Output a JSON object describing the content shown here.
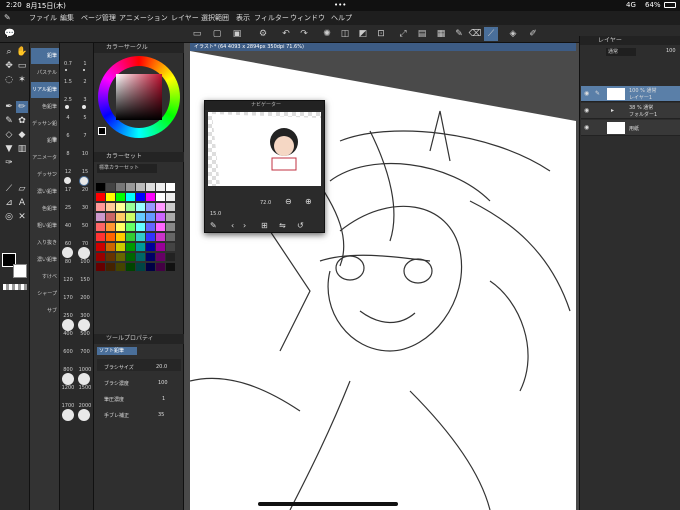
{
  "status": {
    "time": "2:20",
    "date": "8月15日(木)",
    "dots": "•••",
    "signal": "4G",
    "battery": "64%"
  },
  "menu": [
    "ファイル",
    "編集",
    "ページ管理",
    "アニメーション",
    "レイヤー",
    "選択範囲",
    "表示",
    "フィルター",
    "ウィンドウ",
    "ヘルプ"
  ],
  "document": {
    "tab": "イラスト* (64 4093 x 2894px 350dpi 71.6%)"
  },
  "subtools": [
    "鉛筆",
    "パステル",
    "リアル鉛筆",
    "色鉛筆",
    "デッサン鉛筆",
    "鉛筆",
    "アニメーター",
    "デッサン",
    "濃い鉛筆",
    "色鉛筆",
    "粗い鉛筆",
    "入り抜き",
    "濃い鉛筆",
    "すけべ",
    "シャープ",
    "サブ"
  ],
  "brush_sizes": [
    "0.7",
    "1",
    "1.5",
    "2",
    "2.5",
    "3",
    "4",
    "5",
    "6",
    "7",
    "8",
    "10",
    "12",
    "15",
    "17",
    "20",
    "25",
    "30",
    "40",
    "50",
    "60",
    "70",
    "80",
    "100",
    "120",
    "150",
    "170",
    "200",
    "250",
    "300",
    "400",
    "500",
    "600",
    "700",
    "800",
    "1000",
    "1200",
    "1500",
    "1700",
    "2000"
  ],
  "panels": {
    "color_wheel": "カラーサークル",
    "color_set": "カラーセット",
    "color_set_name": "標準カラーセット",
    "tool_property": "ツールプロパティ",
    "tool_name": "ソフト鉛筆",
    "navigator": "ナビゲーター",
    "layer": "レイヤー"
  },
  "tool_props": [
    {
      "label": "ブラシサイズ",
      "value": "20.0"
    },
    {
      "label": "ブラシ濃度",
      "value": "100"
    },
    {
      "label": "筆圧濃度",
      "value": "1"
    },
    {
      "label": "手ブレ補正",
      "value": "35"
    }
  ],
  "navigator": {
    "zoom": "72.0",
    "angle": "15.0"
  },
  "layers": {
    "blend": "通常",
    "opacity": "100",
    "items": [
      {
        "line1": "100 % 通常",
        "line2": "レイヤー1"
      },
      {
        "line1": "38 % 通常",
        "line2": "フォルダー1"
      },
      {
        "line1": "",
        "line2": "用紙"
      }
    ]
  },
  "colors": {
    "accent": "#4a6f9a",
    "selected": "#5a7fa8",
    "canvas": "#ffffff"
  }
}
